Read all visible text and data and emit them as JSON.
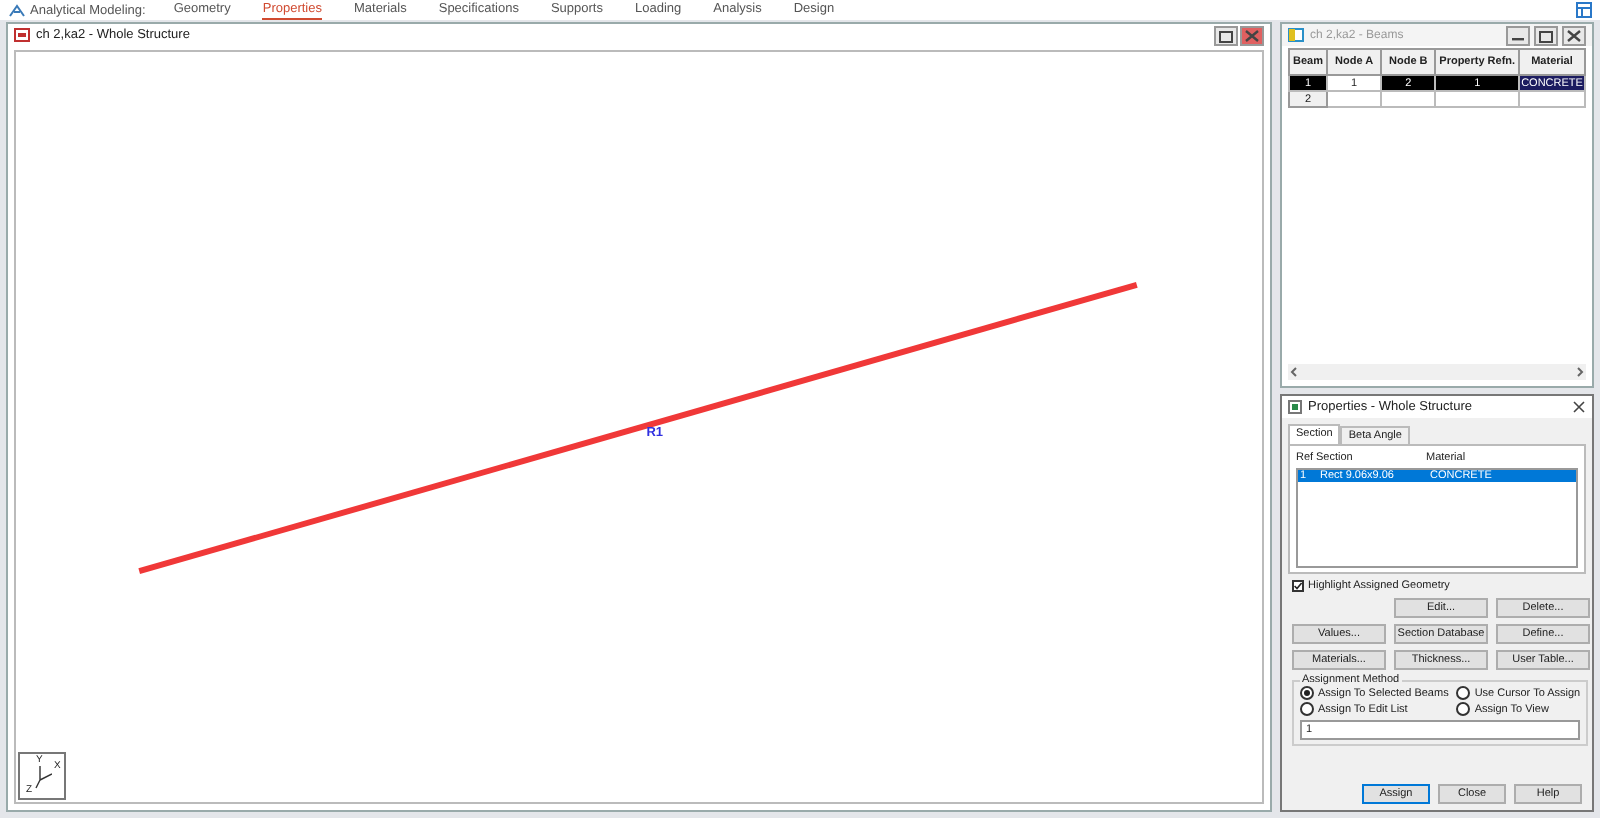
{
  "menu": {
    "app_label": "Analytical Modeling:",
    "items": [
      {
        "label": "Geometry",
        "selected": false
      },
      {
        "label": "Properties",
        "selected": true
      },
      {
        "label": "Materials",
        "selected": false
      },
      {
        "label": "Specifications",
        "selected": false
      },
      {
        "label": "Supports",
        "selected": false
      },
      {
        "label": "Loading",
        "selected": false
      },
      {
        "label": "Analysis",
        "selected": false
      },
      {
        "label": "Design",
        "selected": false
      }
    ]
  },
  "viewport": {
    "title": "ch 2,ka2 - Whole Structure",
    "beam_label": "R1",
    "axis_labels": [
      "Y",
      "X",
      "Z"
    ]
  },
  "beams_window": {
    "title": "ch 2,ka2 - Beams",
    "columns": [
      "Beam",
      "Node A",
      "Node B",
      "Property Refn.",
      "Material"
    ],
    "rows": [
      {
        "cells": [
          {
            "text": "1",
            "selected": true
          },
          {
            "text": "1",
            "selected": false
          },
          {
            "text": "2",
            "selected": true
          },
          {
            "text": "1",
            "selected": true
          },
          {
            "text": "CONCRETE",
            "selected": true
          }
        ]
      },
      {
        "cells": [
          {
            "text": "2",
            "selected": false
          }
        ]
      }
    ]
  },
  "properties_dialog": {
    "title": "Properties - Whole Structure",
    "tabs": [
      {
        "label": "Section",
        "selected": true
      },
      {
        "label": "Beta Angle",
        "selected": false
      }
    ],
    "list_columns": [
      "Ref",
      "Section",
      "Material"
    ],
    "list_rows": [
      {
        "cells": [
          "1",
          "Rect 9.06x9.06",
          "CONCRETE"
        ],
        "selected": true
      }
    ],
    "highlight": {
      "label": "Highlight Assigned Geometry",
      "checked": true
    },
    "buttons": [
      "Edit...",
      "Delete...",
      "Values...",
      "Section Database",
      "Define...",
      "Materials...",
      "Thickness...",
      "User Table..."
    ],
    "assignment": {
      "title": "Assignment Method",
      "options": [
        {
          "label": "Assign To Selected Beams",
          "selected": true
        },
        {
          "label": "Use Cursor To Assign",
          "selected": false
        },
        {
          "label": "Assign To Edit List",
          "selected": false
        },
        {
          "label": "Assign To View",
          "selected": false
        }
      ],
      "value": "1"
    },
    "footer_buttons": [
      {
        "label": "Assign",
        "default": true
      },
      {
        "label": "Close",
        "default": false
      },
      {
        "label": "Help",
        "default": false
      }
    ]
  }
}
